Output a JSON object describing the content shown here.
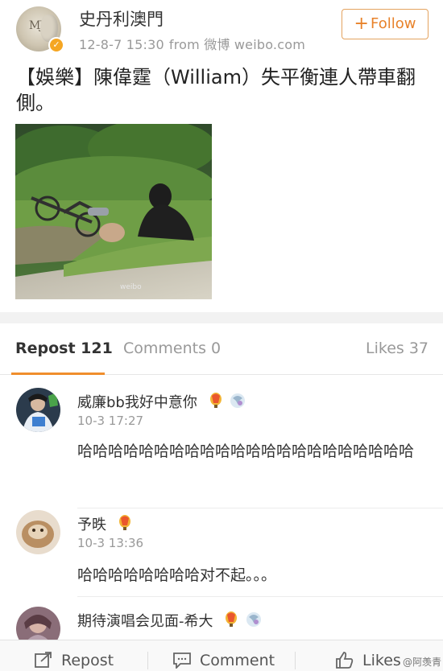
{
  "post": {
    "author": "史丹利澳門",
    "time": "12-8-7 15:30",
    "source": "from 微博 weibo.com",
    "follow_label": "Follow",
    "text": "【娛樂】陳偉霆（William）失平衡連人帶車翻側。",
    "image_watermark": "weibo"
  },
  "tabs": {
    "repost": "Repost 121",
    "comments": "Comments 0",
    "likes": "Likes 37",
    "active": "repost",
    "accent": "#f08e2c"
  },
  "comments": [
    {
      "name": "威廉bb我好中意你",
      "time": "10-3 17:27",
      "text": "哈哈哈哈哈哈哈哈哈哈哈哈哈哈哈哈哈哈哈哈哈哈",
      "badges": [
        "balloon-icon",
        "vip-icon"
      ]
    },
    {
      "name": "予昳",
      "time": "10-3 13:36",
      "text": "哈哈哈哈哈哈哈哈对不起。。。",
      "badges": [
        "balloon-icon"
      ]
    },
    {
      "name": "期待演唱会见面-希大",
      "time": "",
      "text": "",
      "badges": [
        "balloon-icon",
        "vip-icon"
      ]
    }
  ],
  "toolbar": {
    "repost": "Repost",
    "comment": "Comment",
    "like": "Likes"
  },
  "watermark": "@阿羡青"
}
